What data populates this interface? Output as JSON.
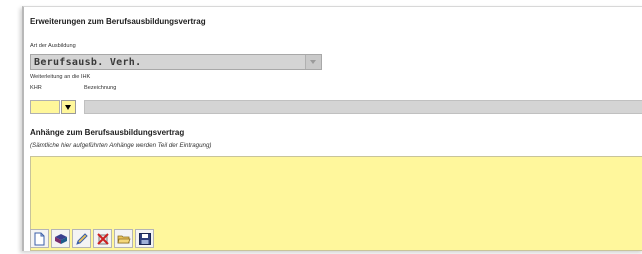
{
  "section": {
    "title": "Erweiterungen zum Berufsausbildungsvertrag",
    "art_label": "Art der Ausbildung",
    "art_value": "Berufsausb. Verh.",
    "weiterleitung_label": "Weiterleitung an die IHK",
    "khr_label": "KHR",
    "bezeichnung_label": "Bezeichnung",
    "khr_value": "",
    "bezeichnung_value": ""
  },
  "anhaenge": {
    "title": "Anhänge zum Berufsausbildungsvertrag",
    "note": "(Sämtliche hier aufgeführten Anhänge werden Teil der Eintragung)"
  },
  "toolbar": {
    "buttons": [
      {
        "icon": "new-document-icon"
      },
      {
        "icon": "book-stack-icon"
      },
      {
        "icon": "edit-pen-icon"
      },
      {
        "icon": "delete-icon"
      },
      {
        "icon": "open-folder-icon"
      },
      {
        "icon": "save-disk-icon"
      }
    ]
  },
  "colors": {
    "field_yellow": "#fff79a",
    "field_gray": "#d4d4d4",
    "accent_blue": "#3b5fa8"
  }
}
